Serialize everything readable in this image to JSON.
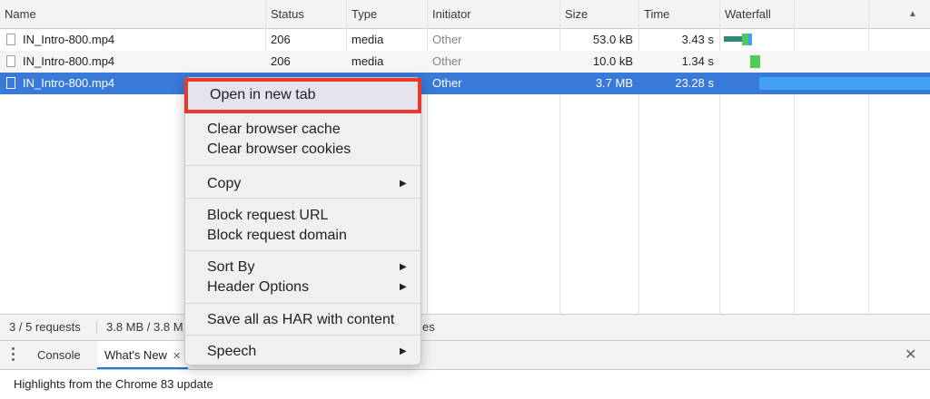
{
  "table": {
    "columns": [
      "Name",
      "Status",
      "Type",
      "Initiator",
      "Size",
      "Time",
      "Waterfall"
    ],
    "rows": [
      {
        "name": "IN_Intro-800.mp4",
        "status": "206",
        "type": "media",
        "initiator": "Other",
        "size": "53.0 kB",
        "time": "3.43 s",
        "waterfall_start_fraction": 0.02,
        "waterfall_end_fraction": 0.17
      },
      {
        "name": "IN_Intro-800.mp4",
        "status": "206",
        "type": "media",
        "initiator": "Other",
        "size": "10.0 kB",
        "time": "1.34 s",
        "waterfall_start_fraction": 0.15,
        "waterfall_end_fraction": 0.2
      },
      {
        "name": "IN_Intro-800.mp4",
        "status": "",
        "type": "",
        "initiator": "Other",
        "size": "3.7 MB",
        "time": "23.28 s",
        "waterfall_start_fraction": 0.19,
        "waterfall_end_fraction": 1.0,
        "selected": true
      }
    ]
  },
  "statusbar": {
    "requests": "3 / 5 requests",
    "transferred": "3.8 MB / 3.8 M",
    "tail": "es"
  },
  "context_menu": {
    "open_new_tab": "Open in new tab",
    "clear_cache": "Clear browser cache",
    "clear_cookies": "Clear browser cookies",
    "copy": "Copy",
    "block_url": "Block request URL",
    "block_domain": "Block request domain",
    "sort_by": "Sort By",
    "header_options": "Header Options",
    "save_har": "Save all as HAR with content",
    "speech": "Speech"
  },
  "drawer": {
    "tabs": [
      "Console",
      "What's New"
    ],
    "active_tab": "What's New",
    "content": "Highlights from the Chrome 83 update"
  },
  "icons": {
    "sort": "sort-ascending-icon",
    "kebab": "more-vertical-icon",
    "close": "close-icon",
    "file": "file-icon",
    "submenu": "submenu-arrow-icon"
  },
  "colors": {
    "selection": "#3879d9",
    "highlight_border": "#e8392b",
    "waterfall_blue": "#42a1f0",
    "waterfall_green": "#4fca5b",
    "waterfall_teal": "#2e8b79"
  }
}
